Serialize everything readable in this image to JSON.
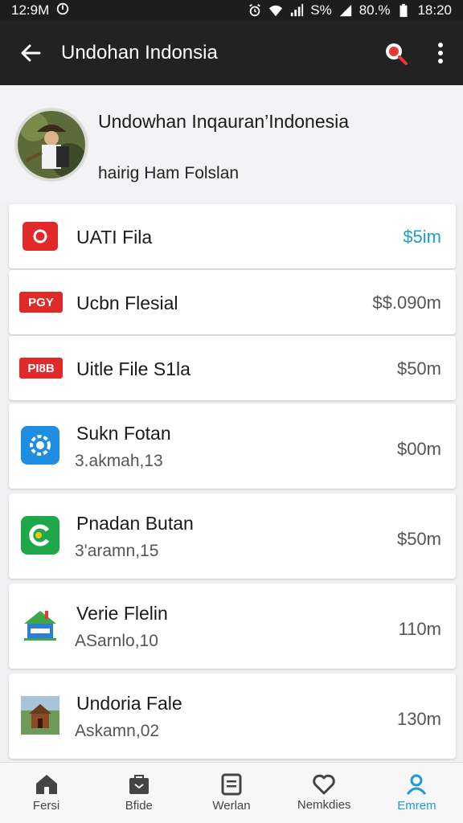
{
  "status_bar": {
    "time_left": "12:9M",
    "battery": "80.%",
    "time_right": "18:20",
    "signal_text": "S%"
  },
  "app_bar": {
    "title": "Undohan Indonsia",
    "back_icon": "arrow-left-icon",
    "search_icon": "search-icon",
    "more_icon": "more-vert-icon"
  },
  "profile": {
    "title": "Undowhan Inqauran’Indonesia",
    "subtitle": "hairig Ham Folslan"
  },
  "items": [
    {
      "title": "UATI Fila",
      "subtitle": "",
      "amount": "$5im",
      "amount_color": "#1e9ad6",
      "icon": "red-rounded-app-icon"
    },
    {
      "title": "Ucbn Flesial",
      "subtitle": "",
      "amount": "$$.090m",
      "amount_color": "#555555",
      "icon": "red-pgy-badge-icon",
      "icon_text": "PGY"
    },
    {
      "title": "Uitle File S1la",
      "subtitle": "",
      "amount": "$50m",
      "amount_color": "#555555",
      "icon": "red-pi-badge-icon",
      "icon_text": "PI8B"
    },
    {
      "title": "Sukn Fotan",
      "subtitle": "3.akmah,13",
      "amount": "$00m",
      "amount_color": "#555555",
      "icon": "blue-gear-icon"
    },
    {
      "title": "Pnadan Butan",
      "subtitle": "3'aramn,15",
      "amount": "$50m",
      "amount_color": "#555555",
      "icon": "green-c-icon"
    },
    {
      "title": "Verie Flelin",
      "subtitle": "ASarnlo,10",
      "amount": "110m",
      "amount_color": "#555555",
      "icon": "house-icon"
    },
    {
      "title": "Undoria Fale",
      "subtitle": "Askamn,02",
      "amount": "130m",
      "amount_color": "#555555",
      "icon": "hut-landscape-icon"
    }
  ],
  "bottom_nav": [
    {
      "label": "Fersi",
      "icon": "home-icon"
    },
    {
      "label": "Bfide",
      "icon": "bag-icon"
    },
    {
      "label": "Werlan",
      "icon": "document-icon"
    },
    {
      "label": "Nemkdies",
      "icon": "heart-icon"
    },
    {
      "label": "Emrem",
      "icon": "person-icon",
      "active": true
    }
  ]
}
